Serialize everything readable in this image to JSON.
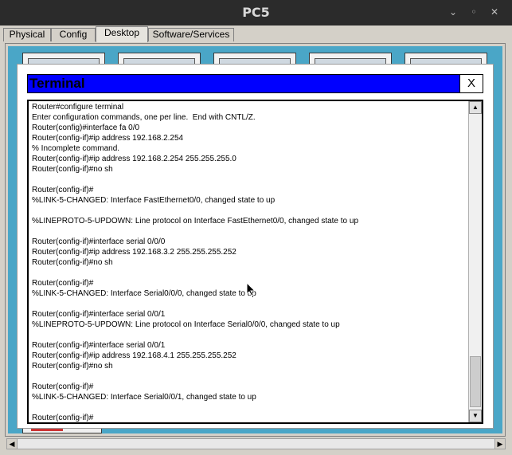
{
  "window": {
    "title": "PC5",
    "controls": {
      "minimize": "⌄",
      "restore": "◦",
      "close": "✕"
    }
  },
  "tabs": [
    {
      "label": "Physical"
    },
    {
      "label": "Config"
    },
    {
      "label": "Desktop"
    },
    {
      "label": "Software/Services"
    }
  ],
  "terminal": {
    "title": "Terminal",
    "close_label": "X",
    "lines": [
      "Router#configure terminal",
      "Enter configuration commands, one per line.  End with CNTL/Z.",
      "Router(config)#interface fa 0/0",
      "Router(config-if)#ip address 192.168.2.254",
      "% Incomplete command.",
      "Router(config-if)#ip address 192.168.2.254 255.255.255.0",
      "Router(config-if)#no sh",
      "",
      "Router(config-if)#",
      "%LINK-5-CHANGED: Interface FastEthernet0/0, changed state to up",
      "",
      "%LINEPROTO-5-UPDOWN: Line protocol on Interface FastEthernet0/0, changed state to up",
      "",
      "Router(config-if)#interface serial 0/0/0",
      "Router(config-if)#ip address 192.168.3.2 255.255.255.252",
      "Router(config-if)#no sh",
      "",
      "Router(config-if)#",
      "%LINK-5-CHANGED: Interface Serial0/0/0, changed state to up",
      "",
      "Router(config-if)#interface serial 0/0/1",
      "%LINEPROTO-5-UPDOWN: Line protocol on Interface Serial0/0/0, changed state to up",
      "",
      "Router(config-if)#interface serial 0/0/1",
      "Router(config-if)#ip address 192.168.4.1 255.255.255.252",
      "Router(config-if)#no sh",
      "",
      "Router(config-if)#",
      "%LINK-5-CHANGED: Interface Serial0/0/1, changed state to up",
      "",
      "Router(config-if)#"
    ]
  },
  "scroll": {
    "up": "▲",
    "down": "▼",
    "left": "◀",
    "right": "▶"
  }
}
